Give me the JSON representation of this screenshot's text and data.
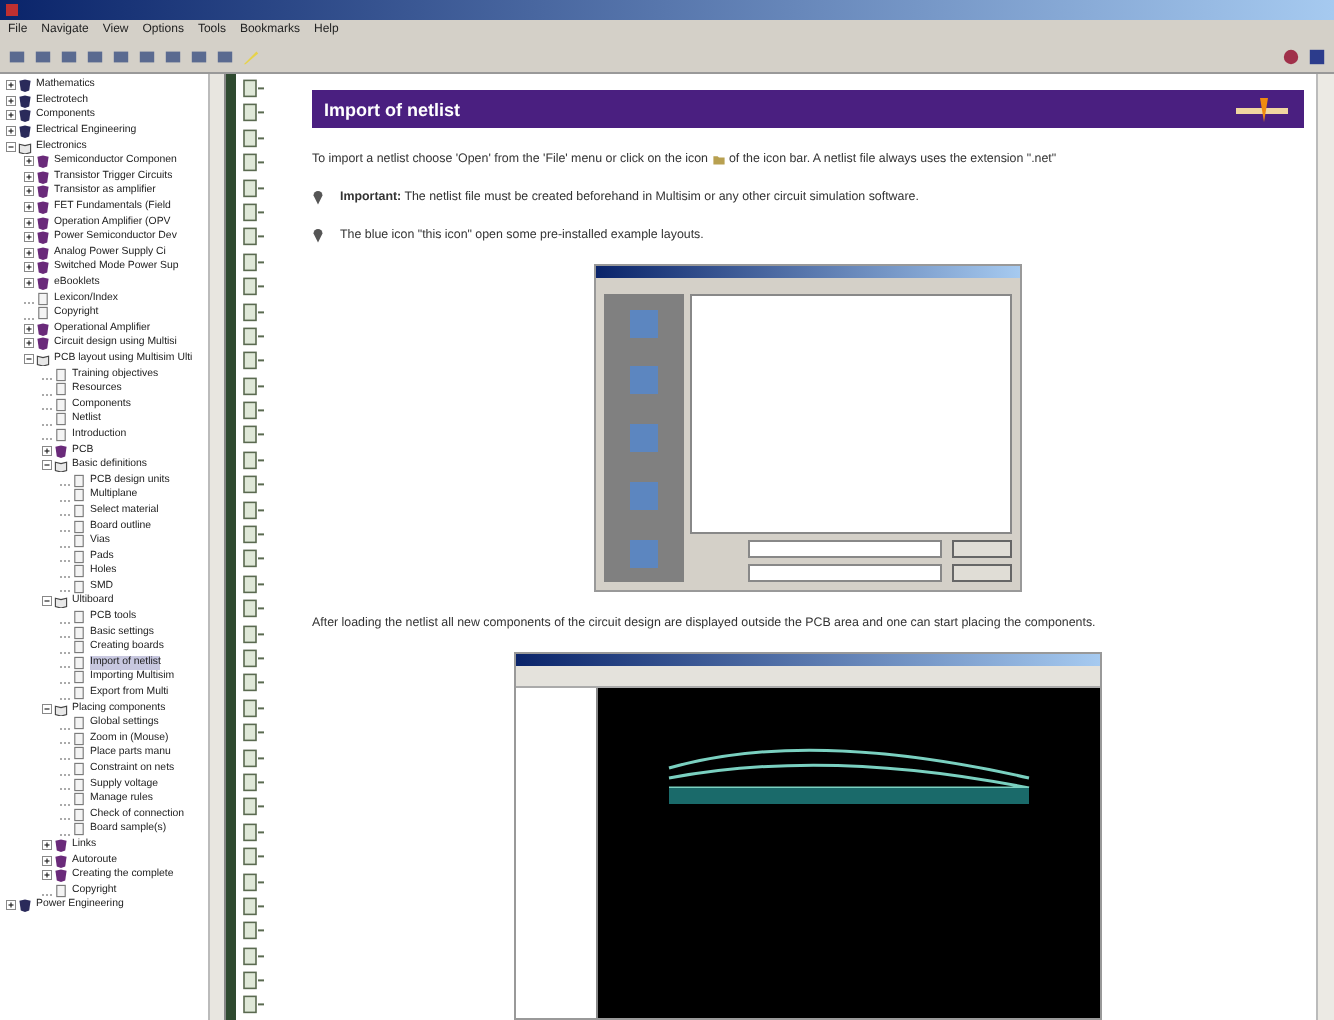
{
  "menu": [
    "File",
    "Navigate",
    "View",
    "Options",
    "Tools",
    "Bookmarks",
    "Help"
  ],
  "tree": [
    {
      "label": "Mathematics",
      "kind": "book",
      "expanded": false,
      "selected": false
    },
    {
      "label": "Electrotech",
      "kind": "book",
      "expanded": false,
      "selected": false
    },
    {
      "label": "Components",
      "kind": "book",
      "expanded": false,
      "selected": false
    },
    {
      "label": "Electrical Engineering",
      "kind": "book",
      "expanded": false,
      "selected": false
    },
    {
      "label": "Electronics",
      "kind": "book",
      "expanded": true,
      "selected": false,
      "children": [
        {
          "label": "Semiconductor Componen",
          "kind": "book",
          "expanded": false,
          "selected": false
        },
        {
          "label": "Transistor Trigger Circuits",
          "kind": "book",
          "expanded": false,
          "selected": false
        },
        {
          "label": "Transistor as amplifier",
          "kind": "book",
          "expanded": false,
          "selected": false
        },
        {
          "label": "FET Fundamentals (Field",
          "kind": "book",
          "expanded": false,
          "selected": false
        },
        {
          "label": "Operation Amplifier (OPV",
          "kind": "book",
          "expanded": false,
          "selected": false
        },
        {
          "label": "Power Semiconductor Dev",
          "kind": "book",
          "expanded": false,
          "selected": false
        },
        {
          "label": "Analog Power Supply Ci",
          "kind": "book",
          "expanded": false,
          "selected": false
        },
        {
          "label": "Switched Mode Power Sup",
          "kind": "book",
          "expanded": false,
          "selected": false
        },
        {
          "label": "eBooklets",
          "kind": "book",
          "expanded": false,
          "selected": false
        },
        {
          "label": "Lexicon/Index",
          "kind": "page",
          "selected": false
        },
        {
          "label": "Copyright",
          "kind": "page",
          "selected": false
        },
        {
          "label": "Operational Amplifier",
          "kind": "book",
          "expanded": false,
          "selected": false
        },
        {
          "label": "Circuit design using Multisi",
          "kind": "book",
          "expanded": false,
          "selected": false
        },
        {
          "label": "PCB layout using Multisim Ulti",
          "kind": "book",
          "expanded": true,
          "selected": false,
          "children": [
            {
              "label": "Training objectives",
              "kind": "page",
              "selected": false
            },
            {
              "label": "Resources",
              "kind": "page",
              "selected": false
            },
            {
              "label": "Components",
              "kind": "page",
              "selected": false
            },
            {
              "label": "Netlist",
              "kind": "page",
              "selected": false
            },
            {
              "label": "Introduction",
              "kind": "page",
              "selected": false
            },
            {
              "label": "PCB",
              "kind": "book",
              "expanded": false,
              "selected": false
            },
            {
              "label": "Basic definitions",
              "kind": "book",
              "expanded": true,
              "selected": false,
              "children": [
                {
                  "label": "PCB design units",
                  "kind": "page",
                  "selected": false
                },
                {
                  "label": "Multiplane",
                  "kind": "page",
                  "selected": false
                },
                {
                  "label": "Select material",
                  "kind": "page",
                  "selected": false
                },
                {
                  "label": "Board outline",
                  "kind": "page",
                  "selected": false
                },
                {
                  "label": "Vias",
                  "kind": "page",
                  "selected": false
                },
                {
                  "label": "Pads",
                  "kind": "page",
                  "selected": false
                },
                {
                  "label": "Holes",
                  "kind": "page",
                  "selected": false
                },
                {
                  "label": "SMD",
                  "kind": "page",
                  "selected": false
                }
              ]
            },
            {
              "label": "Ultiboard",
              "kind": "book",
              "expanded": true,
              "selected": false,
              "children": [
                {
                  "label": "PCB tools",
                  "kind": "page",
                  "selected": false
                },
                {
                  "label": "Basic settings",
                  "kind": "page",
                  "selected": false
                },
                {
                  "label": "Creating boards",
                  "kind": "page",
                  "selected": false
                },
                {
                  "label": "Import of netlist",
                  "kind": "page",
                  "selected": true
                },
                {
                  "label": "Importing Multisim",
                  "kind": "page",
                  "selected": false
                },
                {
                  "label": "Export from Multi",
                  "kind": "page",
                  "selected": false
                }
              ]
            },
            {
              "label": "Placing components",
              "kind": "book",
              "expanded": true,
              "selected": false,
              "children": [
                {
                  "label": "Global settings",
                  "kind": "page",
                  "selected": false
                },
                {
                  "label": "Zoom in (Mouse)",
                  "kind": "page",
                  "selected": false
                },
                {
                  "label": "Place parts manu",
                  "kind": "page",
                  "selected": false
                },
                {
                  "label": "Constraint on nets",
                  "kind": "page",
                  "selected": false
                },
                {
                  "label": "Supply voltage",
                  "kind": "page",
                  "selected": false
                },
                {
                  "label": "Manage rules",
                  "kind": "page",
                  "selected": false
                },
                {
                  "label": "Check of connection",
                  "kind": "page",
                  "selected": false
                },
                {
                  "label": "Board sample(s)",
                  "kind": "page",
                  "selected": false
                }
              ]
            },
            {
              "label": "Links",
              "kind": "book",
              "expanded": false,
              "selected": false
            },
            {
              "label": "Autoroute",
              "kind": "book",
              "expanded": false,
              "selected": false
            },
            {
              "label": "Creating the complete",
              "kind": "book",
              "expanded": false,
              "selected": false
            },
            {
              "label": "Copyright",
              "kind": "page",
              "selected": false
            }
          ]
        }
      ]
    },
    {
      "label": "Power Engineering",
      "kind": "book",
      "expanded": false,
      "selected": false
    }
  ],
  "page": {
    "heading": "Import of netlist",
    "intro": "To import a netlist choose 'Open' from the 'File' menu or click on the icon",
    "intro_end": "of the icon bar. A netlist file always uses the extension \".net\"",
    "notes": [
      "**Important:** The netlist file must be created beforehand in Multisim or any other circuit simulation software.",
      "The blue icon \"this icon\" open some pre-installed example layouts."
    ],
    "after": "After loading the netlist all new components of the circuit design are displayed outside the PCB area and one can start placing the components."
  }
}
